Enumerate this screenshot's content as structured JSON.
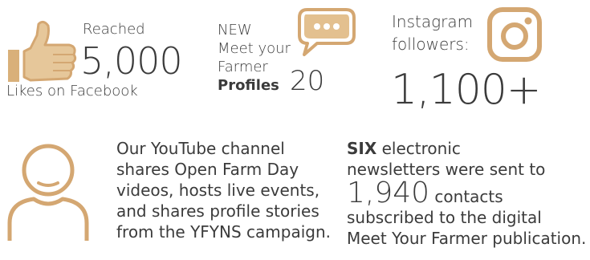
{
  "facebook": {
    "reached": "Reached",
    "count": "5,000",
    "subtitle": "Likes on Facebook",
    "icon": "thumbs-up-icon"
  },
  "profiles": {
    "line1": "NEW",
    "line2": "Meet your",
    "line3": "Farmer",
    "line4": "Profiles",
    "count": "20",
    "icon": "speech-bubble-icon"
  },
  "instagram": {
    "line1": "Instagram",
    "line2": "followers:",
    "count": "1,100+",
    "icon": "instagram-icon"
  },
  "youtube": {
    "lines": [
      "Our YouTube channel",
      "shares Open Farm Day",
      "videos, hosts live events,",
      "and shares profile stories",
      "from the YFYNS campaign."
    ],
    "icon": "user-icon"
  },
  "newsletter": {
    "count_word": "SIX",
    "line1_rest": "electronic",
    "line2": "newsletters were sent to",
    "contacts_count": "1,940",
    "contacts_label": "contacts",
    "line4": "subscribed to the digital",
    "line5": "Meet Your Farmer publication."
  },
  "colors": {
    "accent": "#d4a772",
    "text": "#3b3b3b"
  }
}
